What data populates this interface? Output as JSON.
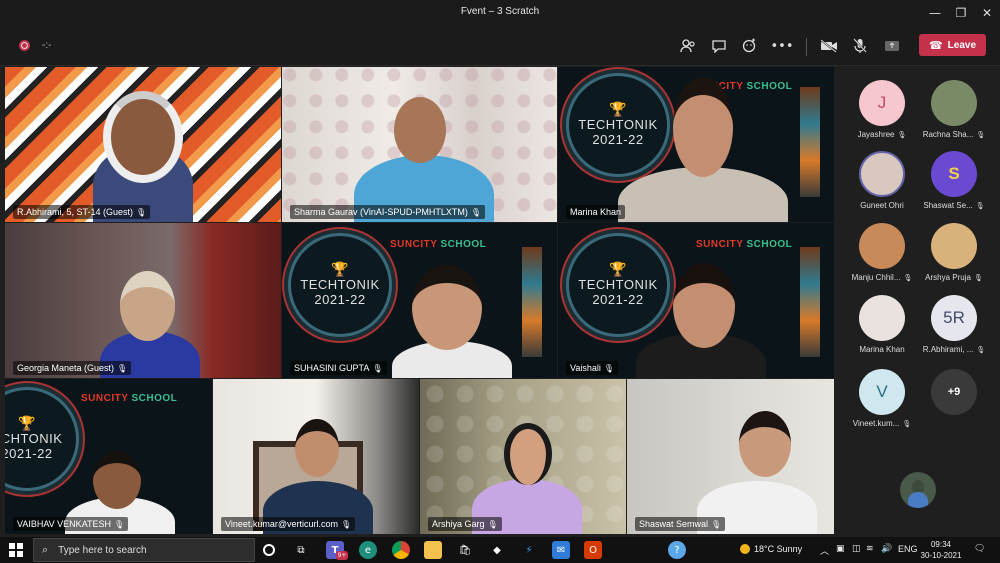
{
  "window": {
    "title": "Fvent – 3 Scratch"
  },
  "toolbar": {
    "timer": "-:-",
    "leave_label": "Leave"
  },
  "tiles": [
    {
      "name": "R.Abhirami, 5, ST-14 (Guest)"
    },
    {
      "name": "Sharma Gaurav (VinAI-SPUD-PMHTLXTM)"
    },
    {
      "name": "Marina Khan"
    },
    {
      "name": "Georgia Maneta (Guest)"
    },
    {
      "name": "SUHASINI GUPTA"
    },
    {
      "name": "Vaishali"
    },
    {
      "name": "VAIBHAV VENKATESH"
    },
    {
      "name": "Vineet.kumar@verticurl.com"
    },
    {
      "name": "Arshiya Garg"
    },
    {
      "name": "Shaswat Semwal"
    }
  ],
  "slide": {
    "event": "TECHTONIK",
    "year": "2021-22",
    "school_red": "SUNCITY",
    "school_green": "SCHOOL",
    "school_green_alt": "SCHOOL",
    "event_partial": "ECHTONIK"
  },
  "participants": [
    {
      "name": "Jayashree",
      "initial": "J",
      "color": "#f6c7cf",
      "text_color": "#c14b69"
    },
    {
      "name": "Rachna Sha...",
      "initial": "",
      "color": "#7a8a66"
    },
    {
      "name": "Guneet Ohri",
      "initial": "",
      "color": "#d9c8c0"
    },
    {
      "name": "Shaswat Se...",
      "initial": "",
      "color": "#6a4ad1"
    },
    {
      "name": "Manju Chhil...",
      "initial": "",
      "color": "#c98a5a"
    },
    {
      "name": "Arshya Pruja",
      "initial": "",
      "color": "#d8b27a"
    },
    {
      "name": "Marina Khan",
      "initial": "",
      "color": "#e9e2de"
    },
    {
      "name": "R.Abhirami, ...",
      "initial": "5R",
      "color": "#e6e6ef",
      "text_color": "#444a6a"
    },
    {
      "name": "Vineet.kum...",
      "initial": "V",
      "color": "#cfe7ee",
      "text_color": "#2c6f86"
    }
  ],
  "overflow": {
    "label": "+9"
  },
  "taskbar": {
    "search_placeholder": "Type here to search",
    "badge": "9+",
    "weather": "18°C  Sunny",
    "lang": "ENG",
    "time": "09:34",
    "date": "30-10-2021"
  },
  "colors": {
    "leave": "#c4314b",
    "accent": "#6264a7"
  }
}
